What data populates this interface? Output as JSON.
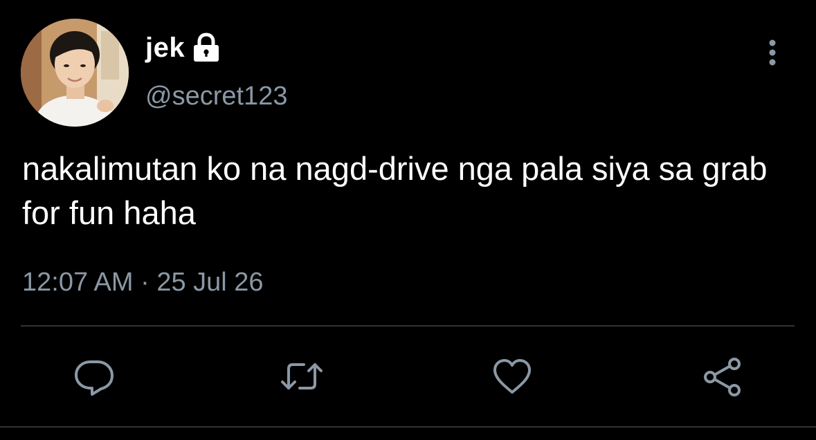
{
  "tweet": {
    "display_name": "jek",
    "handle": "@secret123",
    "text": "nakalimutan ko na nagd-drive nga pala siya sa grab for fun haha",
    "timestamp": "12:07 AM · 25 Jul 26"
  },
  "icons": {
    "protected": "lock-icon",
    "menu": "more-vertical-icon",
    "reply": "reply-icon",
    "retweet": "retweet-icon",
    "like": "heart-icon",
    "share": "share-icon"
  },
  "colors": {
    "background": "#000000",
    "text_primary": "#ffffff",
    "text_secondary": "#8b98a5",
    "divider": "#2f3336"
  }
}
